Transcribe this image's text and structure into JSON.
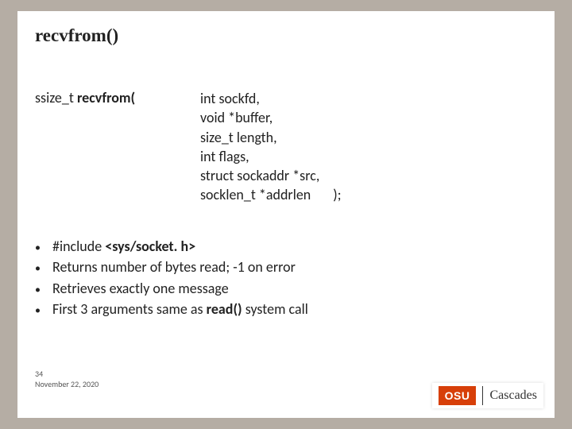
{
  "title": "recvfrom()",
  "signature": {
    "return_and_name": "ssize_t ",
    "fn_name": "recvfrom(",
    "params": [
      "int sockfd,",
      "void *buffer,",
      "size_t length,",
      "int flags,",
      "struct sockaddr *src,",
      "socklen_t *addrlen"
    ],
    "close": ");"
  },
  "bullets": {
    "b0_prefix": "#include ",
    "b0_file": "<sys/socket. h>",
    "b1": "Returns number of bytes read; -1 on error",
    "b2": "Retrieves exactly one message",
    "b3_prefix": "First 3 arguments same as ",
    "b3_bold": "read()",
    "b3_suffix": " system call"
  },
  "footer": {
    "page": "34",
    "date": "November 22, 2020"
  },
  "logo": {
    "badge": "OSU",
    "text": "Cascades"
  }
}
